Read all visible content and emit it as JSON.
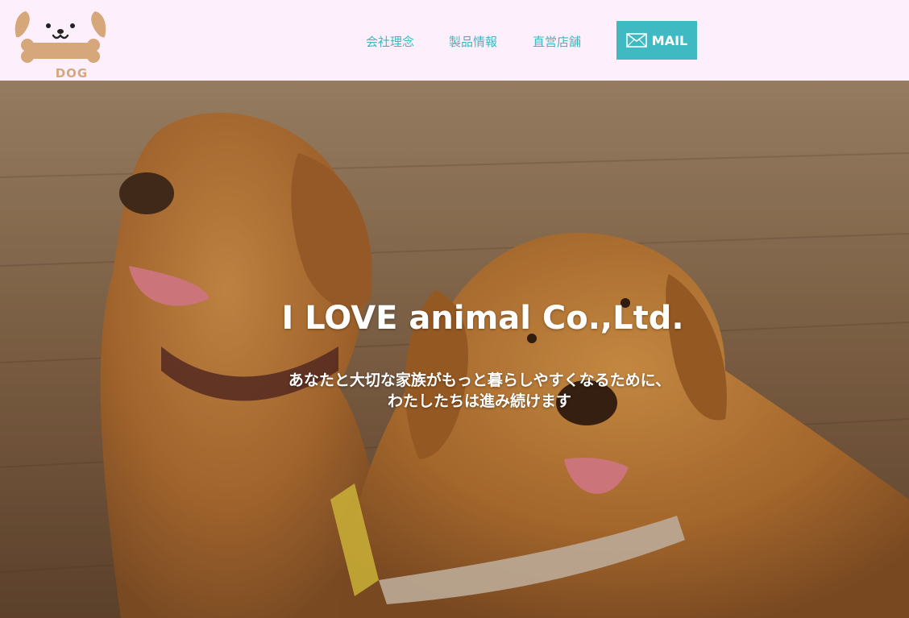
{
  "header": {
    "logo_text": "DOG",
    "nav": [
      {
        "label": "会社理念"
      },
      {
        "label": "製品情報"
      },
      {
        "label": "直営店舗"
      }
    ],
    "mail_label": "MAIL"
  },
  "hero": {
    "title": "I LOVE animal Co.,Ltd.",
    "subtitle_line1": "あなたと大切な家族がもっと暮らしやすくなるために、",
    "subtitle_line2": "わたしたちは進み続けます"
  },
  "colors": {
    "header_bg": "#fdf0fc",
    "accent": "#3fb9c2",
    "logo_tan": "#d6a77a"
  },
  "icons": [
    "dog-logo-icon",
    "mail-icon"
  ]
}
